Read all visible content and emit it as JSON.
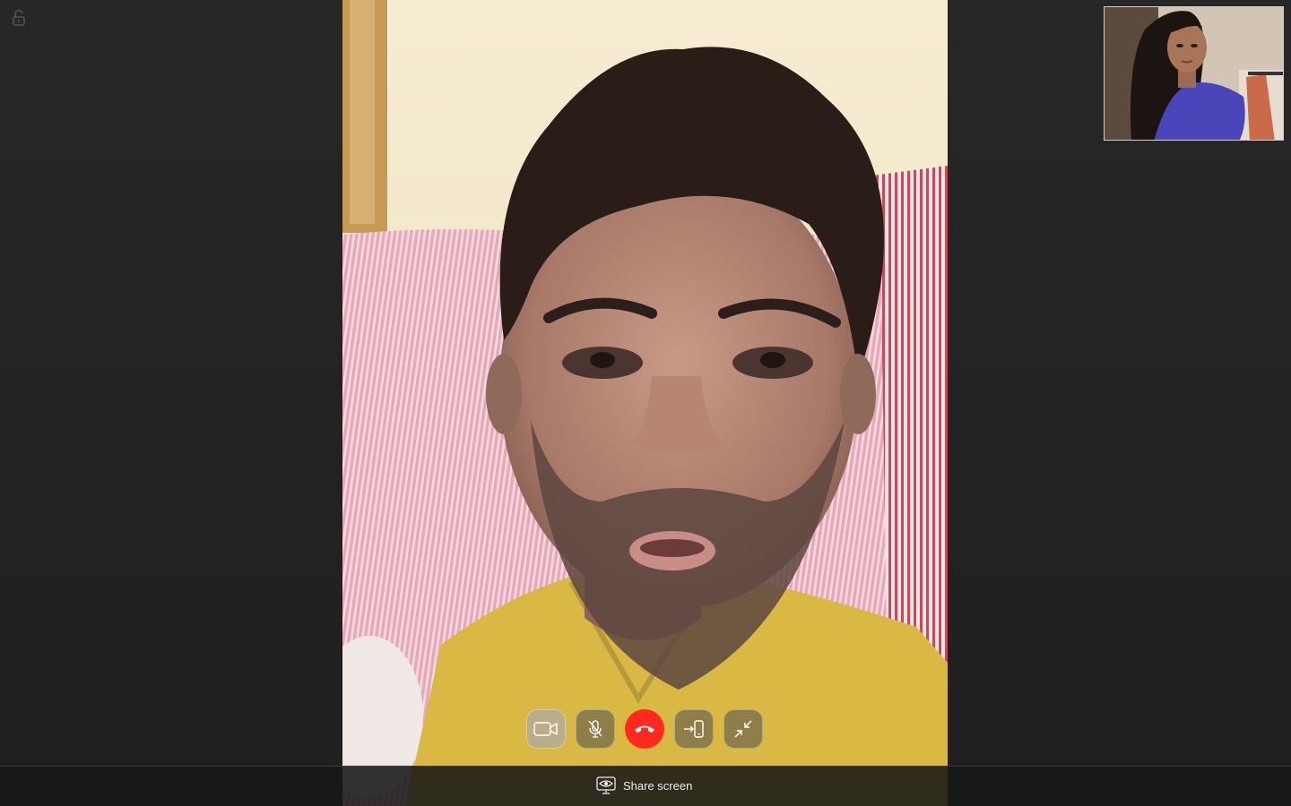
{
  "window": {
    "lock_state": "unlocked"
  },
  "call": {
    "remote_participant_video": "remote-video",
    "self_view_video": "self-video"
  },
  "controls": [
    {
      "name": "camera-button",
      "icon": "video-camera-icon"
    },
    {
      "name": "mute-button",
      "icon": "microphone-muted-icon"
    },
    {
      "name": "end-call-button",
      "icon": "phone-hangup-icon",
      "color": "#ff2a1f"
    },
    {
      "name": "transfer-to-phone-button",
      "icon": "transfer-to-phone-icon"
    },
    {
      "name": "exit-fullscreen-button",
      "icon": "minimize-arrows-icon"
    }
  ],
  "bottom_bar": {
    "share_screen_label": "Share screen",
    "share_screen_icon": "screen-share-eye-icon"
  },
  "colors": {
    "background": "#262626",
    "end_call": "#ff2a1f",
    "text": "#ececec"
  }
}
